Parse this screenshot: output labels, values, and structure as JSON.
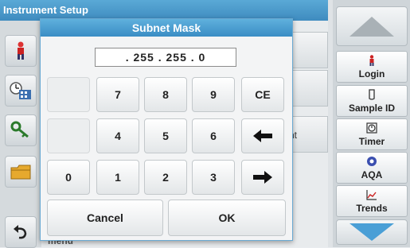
{
  "background": {
    "title": "Instrument Setup",
    "row_partial_text": "nt",
    "bottom_partial_text": "menu"
  },
  "dialog": {
    "title": "Subnet Mask",
    "value": ". 255 . 255 . 0",
    "keys": {
      "k7": "7",
      "k8": "8",
      "k9": "9",
      "ce": "CE",
      "k4": "4",
      "k5": "5",
      "k6": "6",
      "k0": "0",
      "k1": "1",
      "k2": "2",
      "k3": "3"
    },
    "cancel_label": "Cancel",
    "ok_label": "OK"
  },
  "right_panel": {
    "login": "Login",
    "sample_id": "Sample ID",
    "timer": "Timer",
    "aqa": "AQA",
    "trends": "Trends"
  },
  "colors": {
    "title_bar": "#3a8dc4",
    "nav_arrow": "#4a9fd6"
  }
}
